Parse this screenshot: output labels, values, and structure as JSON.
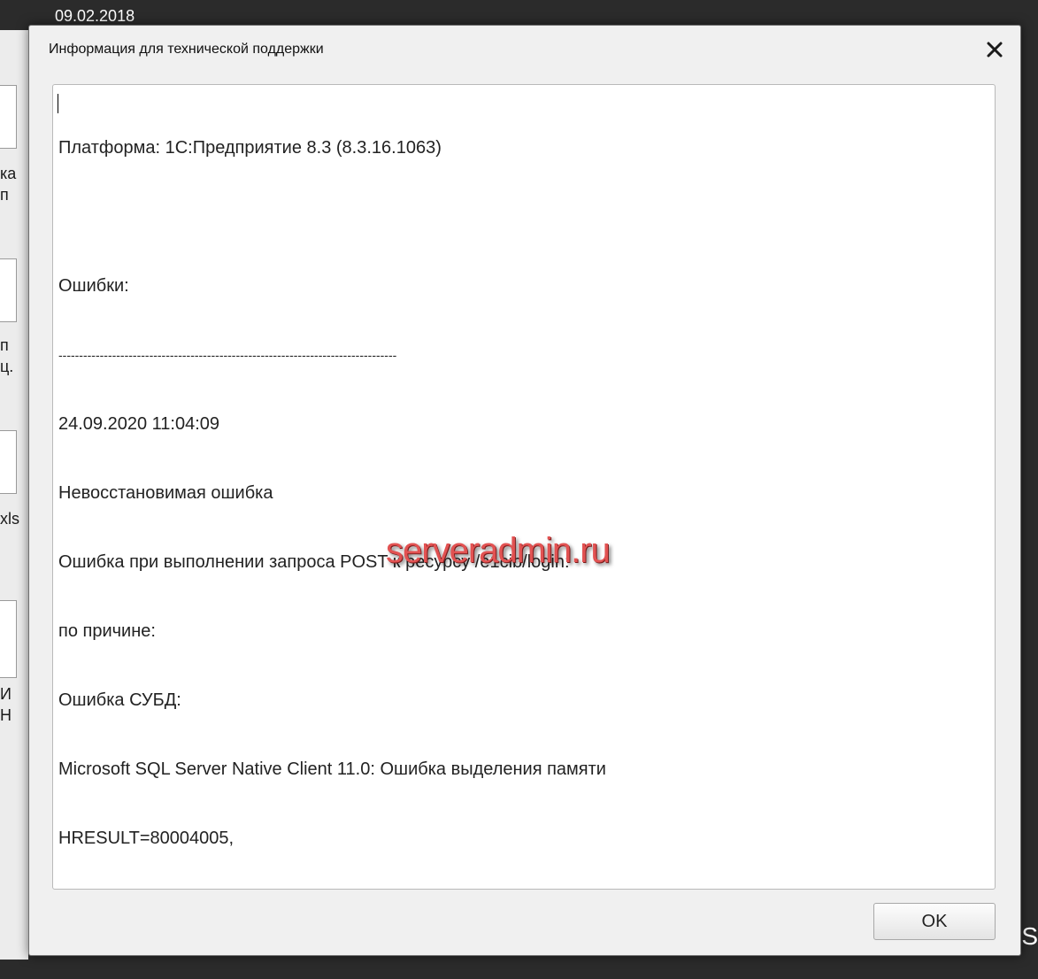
{
  "background": {
    "date_fragment": "09.02.2018",
    "desktop_fragments": [
      "ка",
      "п",
      "п",
      "ц.",
      "xls",
      "И",
      "Н"
    ],
    "right_fragment": "S"
  },
  "dialog": {
    "title": "Информация для технической поддержки",
    "close_icon": "close-icon",
    "content_lines": [
      "Платформа: 1С:Предприятие 8.3 (8.3.16.1063)",
      "",
      "Ошибки:",
      "----------------------------------------------------------------------------------",
      "24.09.2020 11:04:09",
      "Невосстановимая ошибка",
      "Ошибка при выполнении запроса POST к ресурсу /e1cib/login:",
      "по причине:",
      "Ошибка СУБД:",
      "Microsoft SQL Server Native Client 11.0: Ошибка выделения памяти",
      "HRESULT=80004005,"
    ],
    "ok_label": "OK"
  },
  "watermark": "serveradmin.ru",
  "colors": {
    "watermark": "#e25252",
    "dialog_bg": "#f0f0f0",
    "text": "#222222"
  }
}
